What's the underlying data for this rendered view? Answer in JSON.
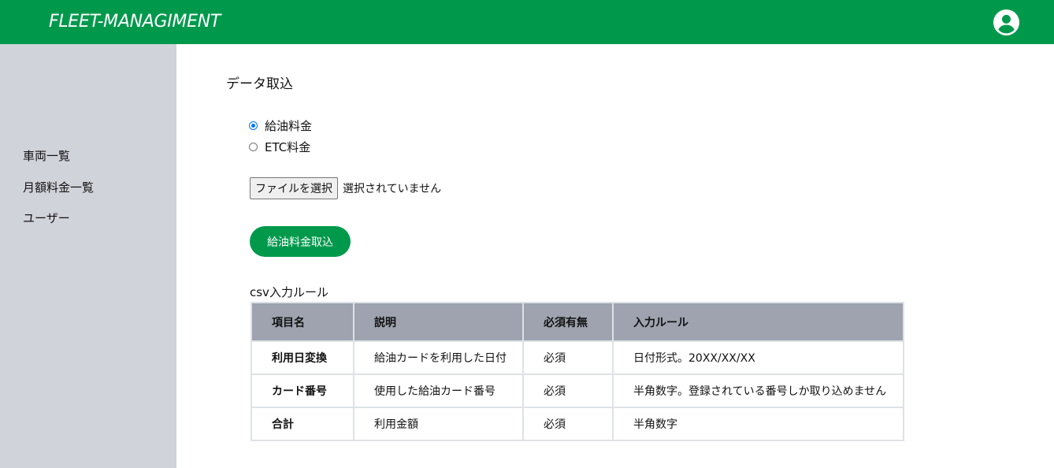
{
  "header": {
    "brand": "FLEET-MANAGIMENT",
    "user_icon": "account-circle-icon",
    "color": "#00994c"
  },
  "sidebar": {
    "items": [
      {
        "label": "車両一覧"
      },
      {
        "label": "月額料金一覧"
      },
      {
        "label": "ユーザー"
      }
    ]
  },
  "main": {
    "title": "データ取込",
    "import_type": {
      "options": [
        {
          "label": "給油料金",
          "checked": true
        },
        {
          "label": "ETC料金",
          "checked": false
        }
      ]
    },
    "file": {
      "button_label": "ファイルを選択",
      "status": "選択されていません"
    },
    "import_button": "給油料金取込",
    "table": {
      "caption": "csv入力ルール",
      "headers": [
        "項目名",
        "説明",
        "必須有無",
        "入力ルール"
      ],
      "rows": [
        [
          "利用日変換",
          "給油カードを利用した日付",
          "必須",
          "日付形式。20XX/XX/XX"
        ],
        [
          "カード番号",
          "使用した給油カード番号",
          "必須",
          "半角数字。登録されている番号しか取り込めません"
        ],
        [
          "合計",
          "利用金額",
          "必須",
          "半角数字"
        ]
      ]
    }
  }
}
